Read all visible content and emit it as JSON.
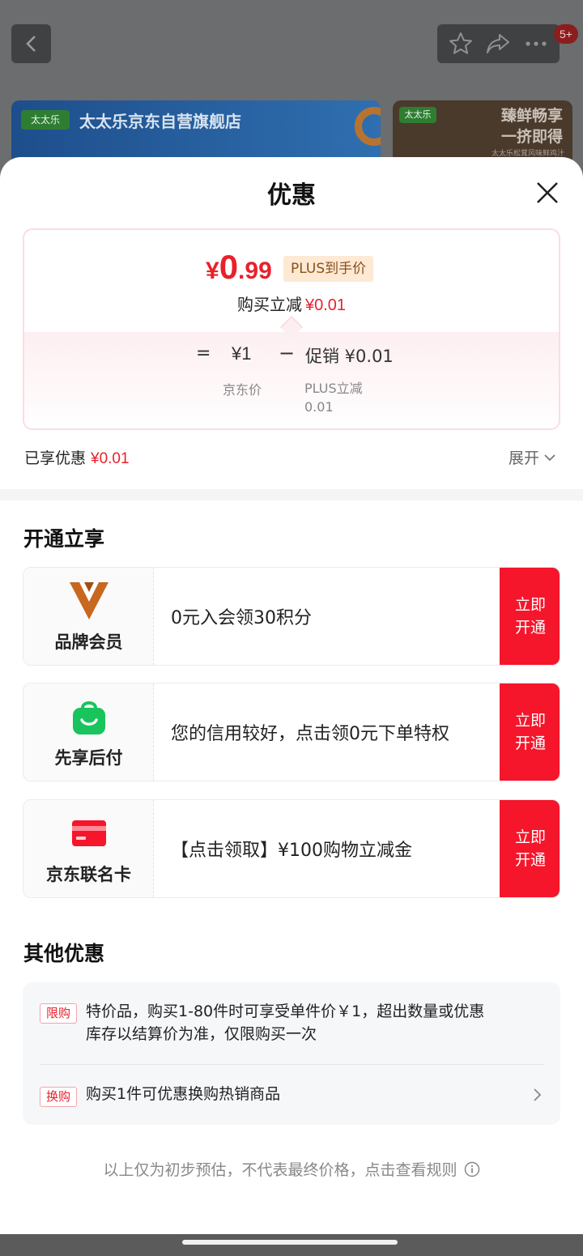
{
  "topbar": {
    "back_icon": "chevron-left-icon",
    "actions": [
      "star-icon",
      "share-icon",
      "more-icon"
    ],
    "badge": "5+"
  },
  "banners": {
    "store_logo": "太太乐",
    "store_name": "太太乐京东自营旗舰店",
    "promo_logo": "太太乐",
    "promo_line1": "臻鲜畅享",
    "promo_line2": "一挤即得",
    "promo_small": "太太乐松茸风味鲜鸡汁"
  },
  "sheet": {
    "title": "优惠",
    "close_icon": "close-icon"
  },
  "price": {
    "symbol": "¥",
    "integer": "0",
    "decimal": ".99",
    "plus_tag": "PLUS到手价",
    "reduce_label": "购买立减",
    "reduce_value": "¥0.01",
    "eq": "=",
    "jd_price": "¥1",
    "minus": "−",
    "promo": "促销 ¥0.01",
    "jd_price_label": "京东价",
    "plus_reduce_label": "PLUS立减",
    "plus_reduce_value": "0.01"
  },
  "enjoyed": {
    "label": "已享优惠",
    "value": "¥0.01",
    "expand_label": "展开"
  },
  "open_section": {
    "title": "开通立享",
    "cards": [
      {
        "name": "品牌会员",
        "desc": "0元入会领30积分",
        "button": "立即\n开通",
        "icon": "brand-member-icon"
      },
      {
        "name": "先享后付",
        "desc": "您的信用较好，点击领0元下单特权",
        "button": "立即\n开通",
        "icon": "shopping-bag-icon"
      },
      {
        "name": "京东联名卡",
        "desc": "【点击领取】¥100购物立减金",
        "button": "立即\n开通",
        "icon": "credit-card-icon"
      }
    ]
  },
  "other_section": {
    "title": "其他优惠",
    "items": [
      {
        "tag": "限购",
        "line1": "特价品，购买1-80件时可享受单件价￥1，超出数量或优惠",
        "line2": "库存以结算价为准，仅限购买一次"
      },
      {
        "tag": "换购",
        "line1": "购买1件可优惠换购热销商品"
      }
    ]
  },
  "footnote": "以上仅为初步预估，不代表最终价格，点击查看规则",
  "colors": {
    "accent_red": "#e8212b",
    "button_red": "#f5162c",
    "plus_tag_bg": "#fde9d4"
  }
}
